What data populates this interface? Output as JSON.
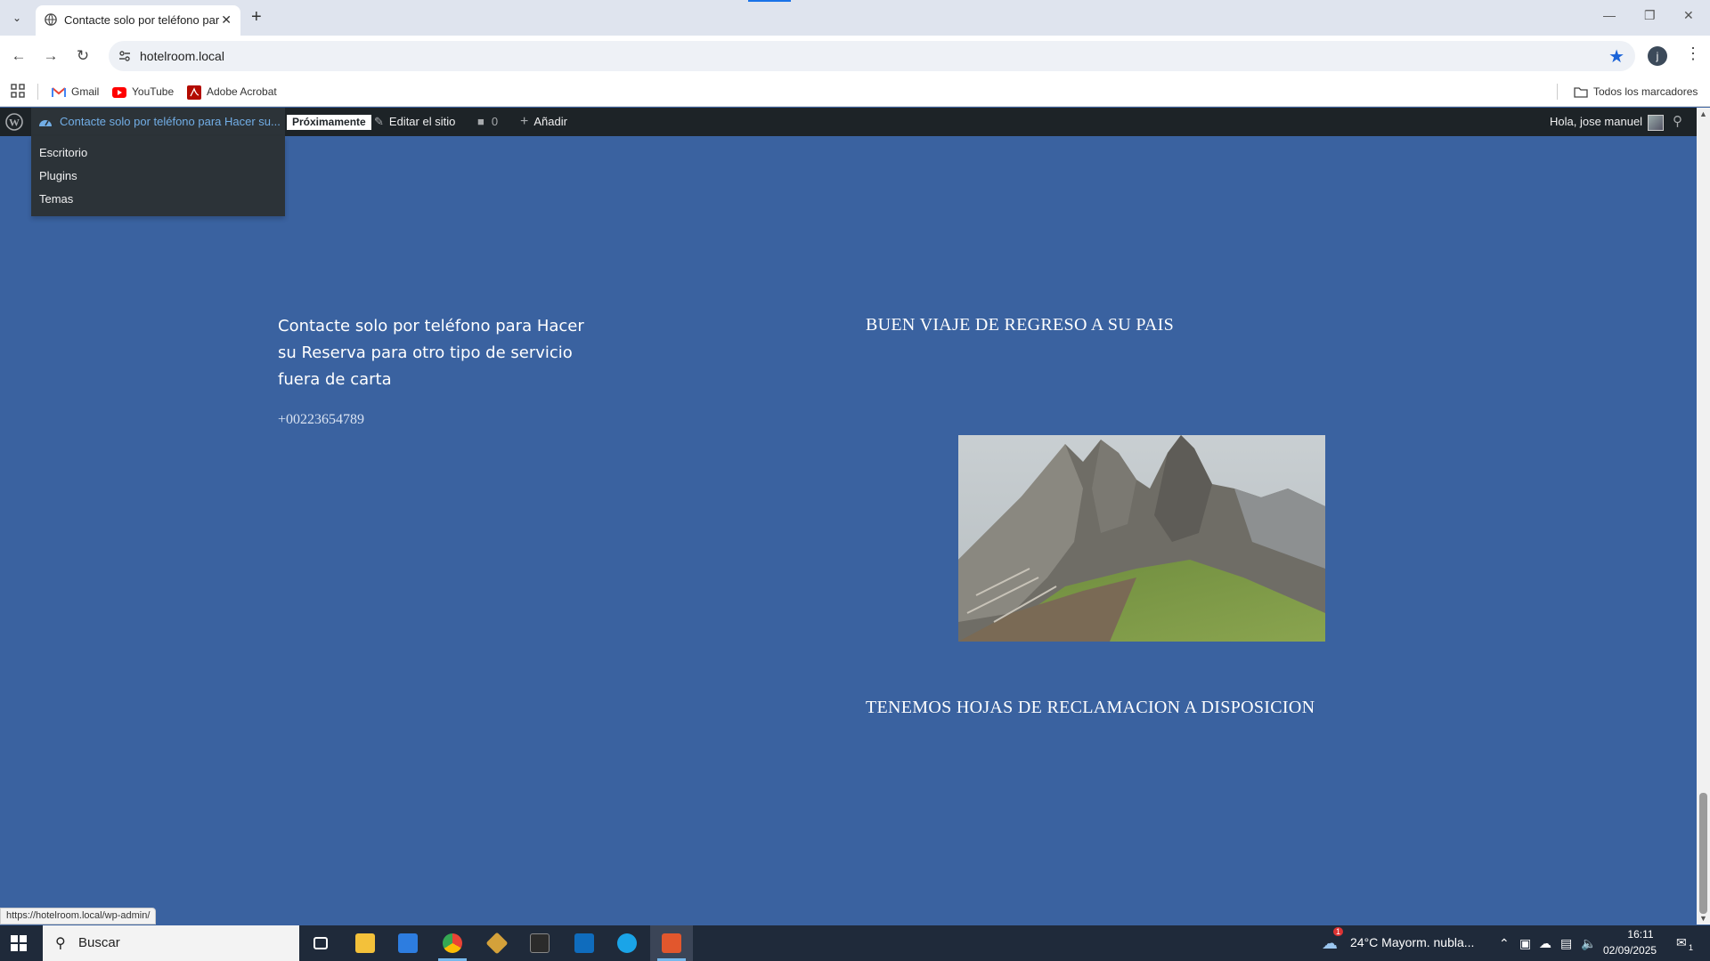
{
  "browser": {
    "tab_title": "Contacte solo por teléfono para Hacer su Reserva",
    "url": "hotelroom.local",
    "bookmarks": [
      {
        "label": "Gmail",
        "icon": "gmail-icon"
      },
      {
        "label": "YouTube",
        "icon": "youtube-icon"
      },
      {
        "label": "Adobe Acrobat",
        "icon": "acrobat-icon"
      }
    ],
    "all_bookmarks": "Todos los marcadores",
    "status_url": "https://hotelroom.local/wp-admin/"
  },
  "adminbar": {
    "site_name": "Contacte solo por teléfono para Hacer su...",
    "badge": "Próximamente",
    "edit_site": "Editar el sitio",
    "comments_count": "0",
    "add_new": "Añadir",
    "greeting": "Hola, jose manuel",
    "dropdown": [
      "Escritorio",
      "Plugins",
      "Temas"
    ]
  },
  "content": {
    "contact_heading": "Contacte solo por teléfono para Hacer su Reserva para otro tipo de servicio fuera de carta",
    "phone": "+00223654789",
    "heading_1": "BUEN VIAJE DE REGRESO A SU PAIS",
    "heading_2": "TENEMOS HOJAS DE RECLAMACION A DISPOSICION"
  },
  "taskbar": {
    "search_label": "Buscar",
    "weather_badge": "1",
    "weather": "24°C  Mayorm. nubla...",
    "time": "16:11",
    "date": "02/09/2025",
    "notifications": "1"
  },
  "colors": {
    "page_background": "#3a62a0",
    "adminbar": "#1d2327",
    "link": "#72aee6"
  }
}
